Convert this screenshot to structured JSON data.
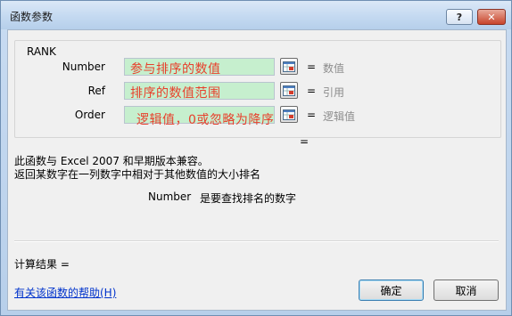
{
  "window": {
    "title": "函数参数",
    "help_label": "?",
    "close_label": "✕"
  },
  "function": {
    "name": "RANK",
    "arguments": [
      {
        "label": "Number",
        "value": "参与排序的数值",
        "result_hint": "数值"
      },
      {
        "label": "Ref",
        "value": "排序的数值范围",
        "result_hint": "引用"
      },
      {
        "label": "Order",
        "value": "逻辑值，0或忽略为降序",
        "result_hint": "逻辑值"
      }
    ],
    "formula_equals": "=",
    "description_line1": "此函数与 Excel 2007 和早期版本兼容。",
    "description_line2": "返回某数字在一列数字中相对于其他数值的大小排名",
    "current_arg_name": "Number",
    "current_arg_desc": "是要查找排名的数字"
  },
  "result_label": "计算结果 =",
  "help_link": "有关该函数的帮助(H)",
  "buttons": {
    "ok": "确定",
    "cancel": "取消"
  },
  "colors": {
    "arg_fill": "#c6efce",
    "arg_text": "#e8402c",
    "link": "#0033cc"
  }
}
